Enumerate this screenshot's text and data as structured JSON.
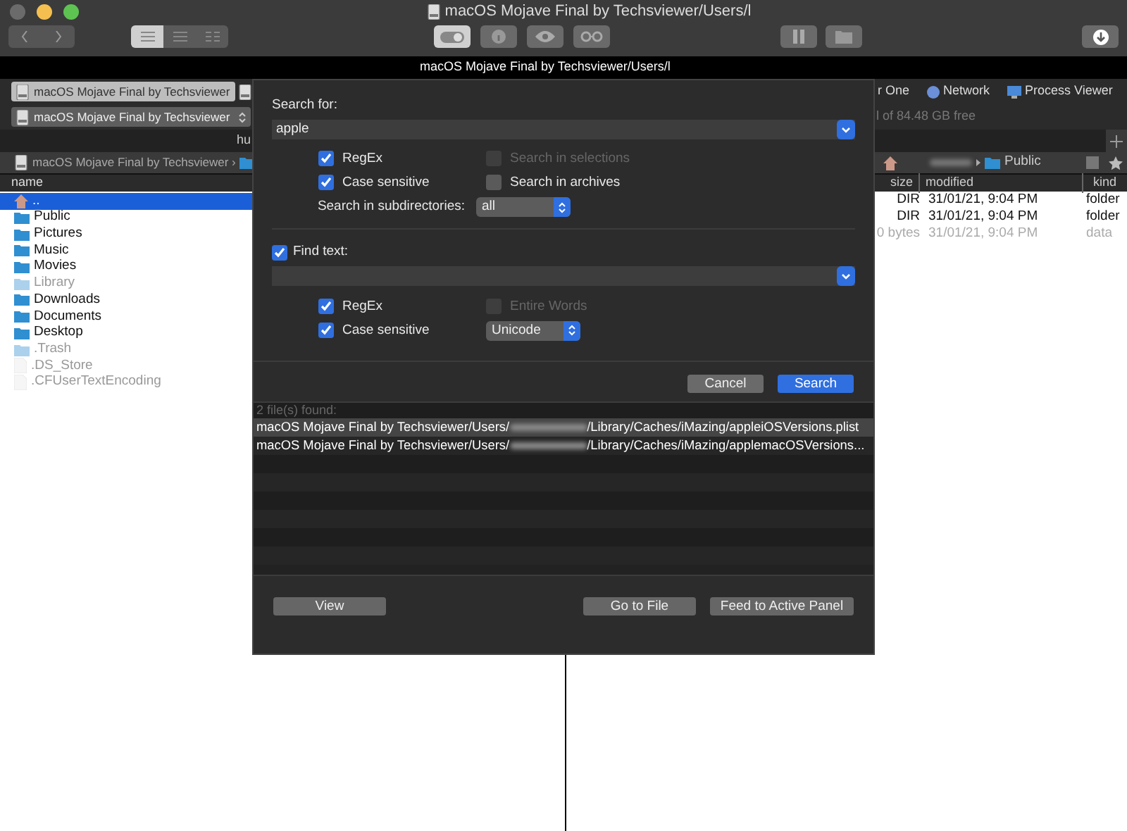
{
  "window": {
    "title": "macOS Mojave Final by Techsviewer/Users/l"
  },
  "toolbar": {
    "view_modes": [
      {
        "selected": true
      },
      {
        "selected": false
      },
      {
        "selected": false
      }
    ]
  },
  "path_bar": {
    "text": "macOS Mojave Final by Techsviewer/Users/l"
  },
  "left_panel": {
    "tab": "macOS Mojave Final by Techsviewer",
    "drive": "macOS Mojave Final by Techsviewer",
    "path_fragment": "hu",
    "breadcrumb": "macOS Mojave Final by Techsviewer ›",
    "column": "name",
    "files": [
      {
        "name": "..",
        "kind": "parent",
        "dimmed": false,
        "selected": true
      },
      {
        "name": "Public",
        "kind": "folder",
        "dimmed": false,
        "selected": false
      },
      {
        "name": "Pictures",
        "kind": "folder",
        "dimmed": false,
        "selected": false
      },
      {
        "name": "Music",
        "kind": "folder",
        "dimmed": false,
        "selected": false
      },
      {
        "name": "Movies",
        "kind": "folder",
        "dimmed": false,
        "selected": false
      },
      {
        "name": "Library",
        "kind": "folder",
        "dimmed": true,
        "selected": false
      },
      {
        "name": "Downloads",
        "kind": "folder",
        "dimmed": false,
        "selected": false
      },
      {
        "name": "Documents",
        "kind": "folder",
        "dimmed": false,
        "selected": false
      },
      {
        "name": "Desktop",
        "kind": "folder",
        "dimmed": false,
        "selected": false
      },
      {
        "name": ".Trash",
        "kind": "folder",
        "dimmed": true,
        "selected": false
      },
      {
        "name": ".DS_Store",
        "kind": "file",
        "dimmed": true,
        "selected": false
      },
      {
        "name": ".CFUserTextEncoding",
        "kind": "file",
        "dimmed": true,
        "selected": false
      }
    ]
  },
  "right_panel": {
    "tabs": [
      {
        "label": "r One",
        "kind": "text"
      },
      {
        "label": "Network",
        "kind": "globe"
      },
      {
        "label": "Process Viewer",
        "kind": "monitor"
      }
    ],
    "free_space": "l of 84.48 GB free",
    "breadcrumb": "Public",
    "columns": [
      "size",
      "modified",
      "kind"
    ],
    "rows": [
      {
        "size": "DIR",
        "modified": "31/01/21, 9:04 PM",
        "kind": "folder",
        "dimmed": false
      },
      {
        "size": "DIR",
        "modified": "31/01/21, 9:04 PM",
        "kind": "folder",
        "dimmed": false
      },
      {
        "size": "0 bytes",
        "modified": "31/01/21, 9:04 PM",
        "kind": "data",
        "dimmed": true
      }
    ]
  },
  "dialog": {
    "search_for": {
      "label": "Search for:",
      "value": "apple"
    },
    "search_options": [
      {
        "label": "RegEx",
        "checked": true,
        "disabled": false
      },
      {
        "label": "Search in selections",
        "checked": false,
        "disabled": true
      },
      {
        "label": "Case sensitive",
        "checked": true,
        "disabled": false
      },
      {
        "label": "Search in archives",
        "checked": false,
        "disabled": false
      }
    ],
    "subdirectories": {
      "label": "Search in subdirectories:",
      "value": "all"
    },
    "find_text": {
      "label": "Find text:",
      "checked": true
    },
    "text_options": [
      {
        "label": "RegEx",
        "checked": true,
        "disabled": false
      },
      {
        "label": "Entire Words",
        "checked": false,
        "disabled": true
      },
      {
        "label": "Case sensitive",
        "checked": true,
        "disabled": false
      }
    ],
    "encoding": "Unicode",
    "buttons": [
      {
        "label": "Cancel",
        "kind": "secondary"
      },
      {
        "label": "Search",
        "kind": "primary"
      }
    ],
    "results": {
      "summary": "2 file(s) found:",
      "items": [
        {
          "prefix": "macOS Mojave Final by Techsviewer/Users/",
          "suffix": "/Library/Caches/iMazing/appleiOSVersions.plist",
          "selected": true
        },
        {
          "prefix": "macOS Mojave Final by Techsviewer/Users/",
          "suffix": "/Library/Caches/iMazing/applemacOSVersions...",
          "selected": false
        }
      ]
    },
    "bottom_buttons": [
      "View",
      "Go to File",
      "Feed to Active Panel"
    ]
  }
}
